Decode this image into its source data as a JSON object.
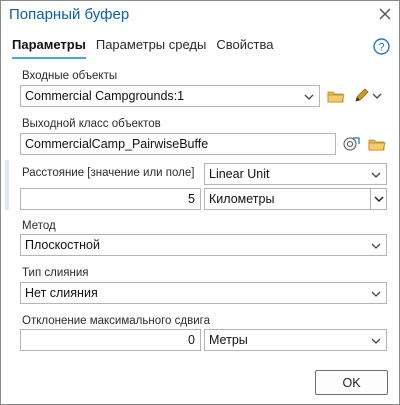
{
  "window": {
    "title": "Попарный буфер"
  },
  "tabs": [
    {
      "label": "Параметры",
      "active": true
    },
    {
      "label": "Параметры среды",
      "active": false
    },
    {
      "label": "Свойства",
      "active": false
    }
  ],
  "params": {
    "input_features": {
      "label": "Входные объекты",
      "value": "Commercial Campgrounds:1"
    },
    "output_class": {
      "label": "Выходной класс объектов",
      "value": "CommercialCamp_PairwiseBuffe"
    },
    "distance": {
      "label": "Расстояние [значение или поле]",
      "type": "Linear Unit",
      "value": "5",
      "unit": "Километры"
    },
    "method": {
      "label": "Метод",
      "value": "Плоскостной"
    },
    "dissolve": {
      "label": "Тип слияния",
      "value": "Нет слияния"
    },
    "deviation": {
      "label": "Отклонение максимального сдвига",
      "value": "0",
      "unit": "Метры"
    }
  },
  "buttons": {
    "ok": "OK"
  },
  "icons": {
    "close": "close-icon",
    "help": "help-icon",
    "folder": "folder-icon",
    "pencil": "pencil-icon",
    "sql": "feature-class-options-icon",
    "chevron": "chevron-down-icon"
  },
  "colors": {
    "accent": "#0c5fa8",
    "tab_underline": "#4aa3df",
    "folder": "#e8b84a",
    "pencil": "#d19a1f"
  }
}
